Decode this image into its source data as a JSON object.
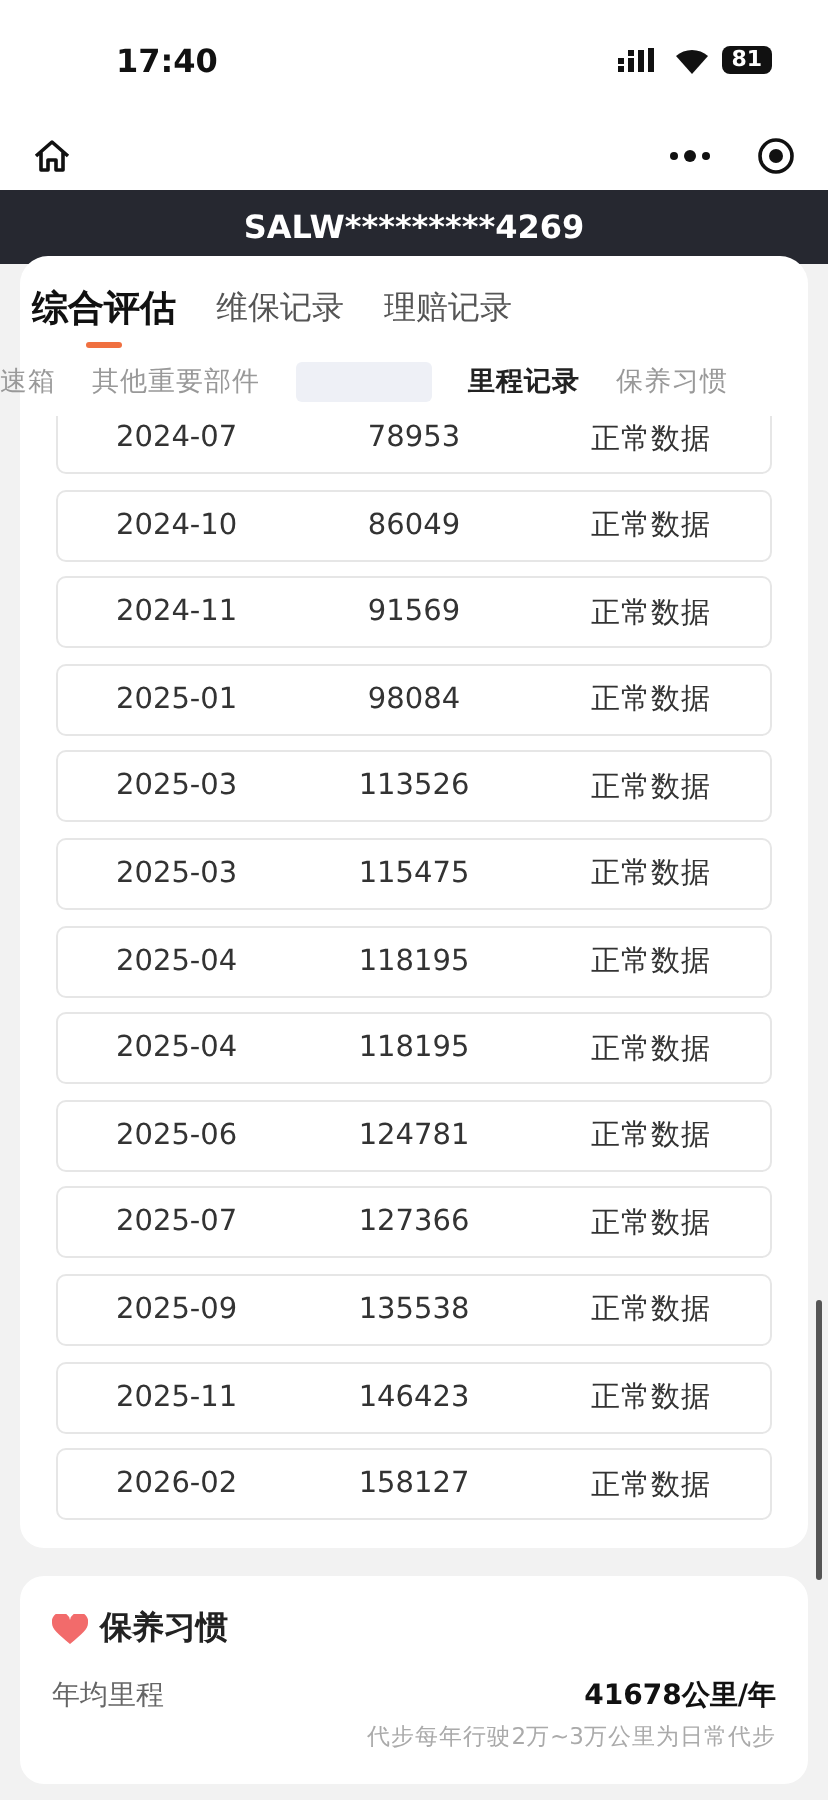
{
  "status_bar": {
    "time": "17:40",
    "battery": "81"
  },
  "plate": "SALW*********4269",
  "tabs": [
    {
      "label": "综合评估",
      "selected": true
    },
    {
      "label": "维保记录",
      "selected": false
    },
    {
      "label": "理赔记录",
      "selected": false
    }
  ],
  "sub_tabs": [
    {
      "label": "速箱",
      "selected": false
    },
    {
      "label": "其他重要部件",
      "selected": false
    },
    {
      "selected": false,
      "kind": "obscured"
    },
    {
      "label": "里程记录",
      "selected": true
    },
    {
      "label": "保养习惯",
      "selected": false
    }
  ],
  "mileage_rows": [
    {
      "date": "2024-07",
      "mileage": "78953",
      "status": "正常数据"
    },
    {
      "date": "2024-10",
      "mileage": "86049",
      "status": "正常数据"
    },
    {
      "date": "2024-11",
      "mileage": "91569",
      "status": "正常数据"
    },
    {
      "date": "2025-01",
      "mileage": "98084",
      "status": "正常数据"
    },
    {
      "date": "2025-03",
      "mileage": "113526",
      "status": "正常数据"
    },
    {
      "date": "2025-03",
      "mileage": "115475",
      "status": "正常数据"
    },
    {
      "date": "2025-04",
      "mileage": "118195",
      "status": "正常数据"
    },
    {
      "date": "2025-04",
      "mileage": "118195",
      "status": "正常数据"
    },
    {
      "date": "2025-06",
      "mileage": "124781",
      "status": "正常数据"
    },
    {
      "date": "2025-07",
      "mileage": "127366",
      "status": "正常数据"
    },
    {
      "date": "2025-09",
      "mileage": "135538",
      "status": "正常数据"
    },
    {
      "date": "2025-11",
      "mileage": "146423",
      "status": "正常数据"
    },
    {
      "date": "2026-02",
      "mileage": "158127",
      "status": "正常数据"
    }
  ],
  "habit": {
    "title": "保养习惯",
    "label": "年均里程",
    "value": "41678公里/年",
    "note": "代步每年行驶2万~3万公里为日常代步"
  }
}
